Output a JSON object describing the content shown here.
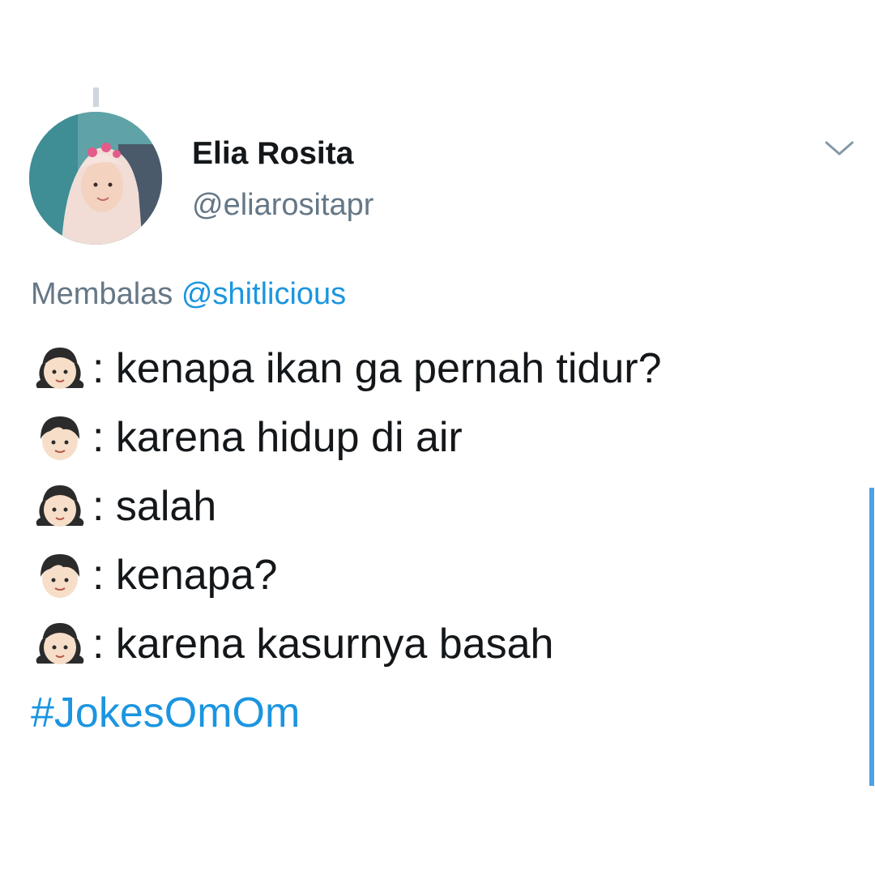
{
  "tweet": {
    "display_name": "Elia Rosita",
    "handle": "@eliarositapr",
    "reply_prefix": "Membalas",
    "reply_to": "@shitlicious",
    "lines": [
      {
        "speaker": "girl",
        "text": ": kenapa ikan ga pernah tidur?"
      },
      {
        "speaker": "boy",
        "text": ": karena hidup di air"
      },
      {
        "speaker": "girl",
        "text": ": salah"
      },
      {
        "speaker": "boy",
        "text": ": kenapa?"
      },
      {
        "speaker": "girl",
        "text": ": karena kasurnya basah"
      }
    ],
    "hashtag": "#JokesOmOm"
  },
  "icons": {
    "menu": "chevron-down-icon",
    "speaker_girl": "girl-emoji-icon",
    "speaker_boy": "boy-emoji-icon"
  },
  "colors": {
    "text": "#14171a",
    "secondary": "#657786",
    "link": "#1b95e0",
    "scrollbar": "#4ba3e8"
  }
}
